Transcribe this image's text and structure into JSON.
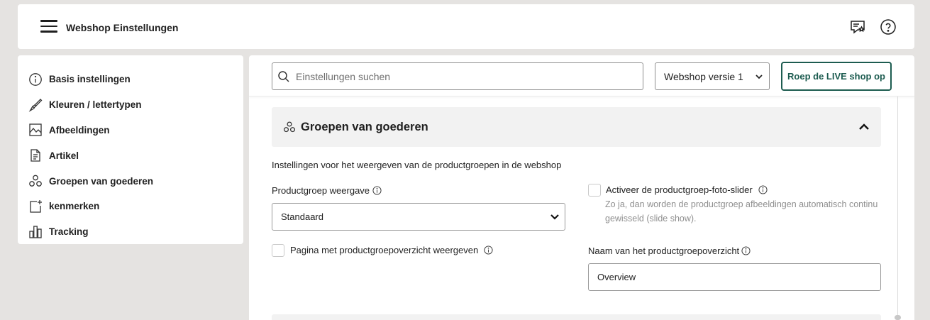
{
  "header": {
    "title": "Webshop Einstellungen",
    "icons": [
      "menu-icon",
      "feedback-icon",
      "help-icon"
    ]
  },
  "sidebar": {
    "items": [
      {
        "label": "Basis instellingen",
        "icon": "info-icon"
      },
      {
        "label": "Kleuren / lettertypen",
        "icon": "brush-icon"
      },
      {
        "label": "Afbeeldingen",
        "icon": "image-icon"
      },
      {
        "label": "Artikel",
        "icon": "document-icon"
      },
      {
        "label": "Groepen van goederen",
        "icon": "groups-icon"
      },
      {
        "label": "kenmerken",
        "icon": "add-feature-icon"
      },
      {
        "label": "Tracking",
        "icon": "bar-chart-icon"
      }
    ]
  },
  "toolbar": {
    "search_placeholder": "Einstellungen suchen",
    "version_select": "Webshop versie 1",
    "live_button": "Roep de LIVE shop op"
  },
  "section": {
    "title": "Groepen van goederen",
    "description": "Instellingen voor het weergeven van de productgroepen in de webshop",
    "productgroup_view_label": "Productgroep weergave",
    "productgroup_view_value": "Standaard",
    "slider_label": "Activeer de productgroep-foto-slider",
    "slider_checked": false,
    "slider_hint": "Zo ja, dan worden de productgroep afbeeldingen automatisch continu gewisseld (slide show).",
    "overview_page_label": "Pagina met productgroepoverzicht weergeven",
    "overview_page_checked": false,
    "overview_name_label": "Naam van het productgroepoverzicht",
    "overview_name_value": "Overview"
  },
  "colors": {
    "accent": "#1d5c50",
    "background": "#e5e3e1",
    "section_header_bg": "#f2f2f2"
  }
}
